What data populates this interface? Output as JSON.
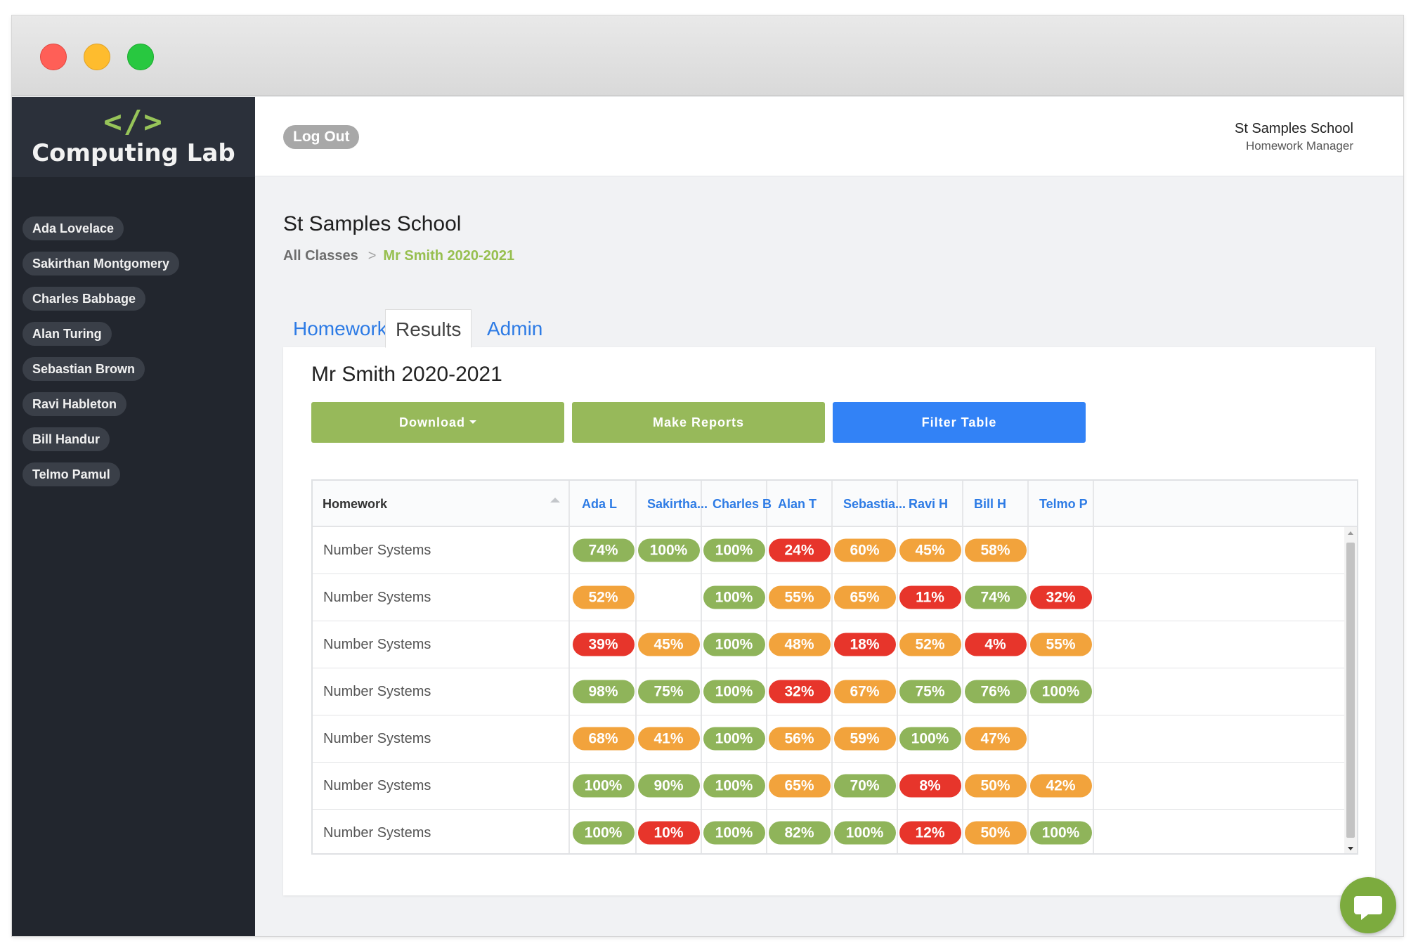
{
  "brand": {
    "icon": "</>",
    "name": "Computing Lab"
  },
  "sidebar": {
    "students": [
      "Ada Lovelace",
      "Sakirthan Montgomery",
      "Charles Babbage",
      "Alan Turing",
      "Sebastian Brown",
      "Ravi Hableton",
      "Bill Handur",
      "Telmo Pamul"
    ]
  },
  "topbar": {
    "logout_label": "Log Out",
    "school": "St Samples School",
    "subtitle": "Homework Manager"
  },
  "page": {
    "title": "St Samples School",
    "breadcrumb": {
      "root": "All Classes",
      "separator": ">",
      "current": "Mr Smith 2020-2021"
    },
    "tabs": [
      "Homework",
      "Results",
      "Admin"
    ],
    "active_tab": "Results"
  },
  "card": {
    "title": "Mr Smith 2020-2021",
    "buttons": {
      "download": "Download",
      "reports": "Make Reports",
      "filter": "Filter Table"
    }
  },
  "table": {
    "homework_header": "Homework",
    "columns": [
      "Ada L",
      "Sakirtha...",
      "Charles B",
      "Alan T",
      "Sebastia...",
      "Ravi H",
      "Bill H",
      "Telmo P"
    ],
    "rows": [
      {
        "homework": "Number Systems",
        "scores": [
          "74%",
          "100%",
          "100%",
          "24%",
          "60%",
          "45%",
          "58%",
          ""
        ]
      },
      {
        "homework": "Number Systems",
        "scores": [
          "52%",
          "",
          "100%",
          "55%",
          "65%",
          "11%",
          "74%",
          "32%"
        ]
      },
      {
        "homework": "Number Systems",
        "scores": [
          "39%",
          "45%",
          "100%",
          "48%",
          "18%",
          "52%",
          "4%",
          "55%"
        ]
      },
      {
        "homework": "Number Systems",
        "scores": [
          "98%",
          "75%",
          "100%",
          "32%",
          "67%",
          "75%",
          "76%",
          "100%"
        ]
      },
      {
        "homework": "Number Systems",
        "scores": [
          "68%",
          "41%",
          "100%",
          "56%",
          "59%",
          "100%",
          "47%",
          ""
        ]
      },
      {
        "homework": "Number Systems",
        "scores": [
          "100%",
          "90%",
          "100%",
          "65%",
          "70%",
          "8%",
          "50%",
          "42%"
        ]
      },
      {
        "homework": "Number Systems",
        "scores": [
          "100%",
          "10%",
          "100%",
          "82%",
          "100%",
          "12%",
          "50%",
          "100%"
        ]
      }
    ],
    "score_colors": {
      "high": "#8fb45a",
      "mid": "#f2a33c",
      "low": "#e7352b"
    }
  },
  "colors": {
    "accent_green": "#97b95a",
    "accent_blue": "#3282f6",
    "sidebar_bg": "#22262e"
  },
  "icons": {
    "chat": "chat-bubble-icon",
    "sort": "sort-asc-icon",
    "dropdown": "caret-down-icon"
  }
}
